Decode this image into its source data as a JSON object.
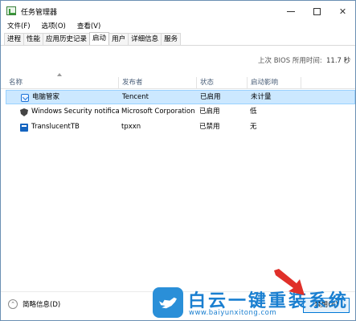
{
  "window": {
    "title": "任务管理器",
    "controls": {
      "minimize": "—",
      "maximize": "",
      "close": "✕"
    }
  },
  "menu": [
    "文件(F)",
    "选项(O)",
    "查看(V)"
  ],
  "tabs": [
    "进程",
    "性能",
    "应用历史记录",
    "启动",
    "用户",
    "详细信息",
    "服务"
  ],
  "active_tab": "启动",
  "bios": {
    "label": "上次 BIOS 所用时间:",
    "value": "11.7 秒"
  },
  "table": {
    "columns": [
      "名称",
      "发布者",
      "状态",
      "启动影响"
    ],
    "rows": [
      {
        "icon": "tencent-pc-manager-icon",
        "name": "电脑管家",
        "publisher": "Tencent",
        "status": "已启用",
        "impact": "未计量",
        "selected": true
      },
      {
        "icon": "shield-icon",
        "name": "Windows Security notifica...",
        "publisher": "Microsoft Corporation",
        "status": "已启用",
        "impact": "低",
        "selected": false
      },
      {
        "icon": "translucenttb-icon",
        "name": "TranslucentTB",
        "publisher": "tpxxn",
        "status": "已禁用",
        "impact": "无",
        "selected": false
      }
    ]
  },
  "footer": {
    "less_info": "简略信息(D)",
    "disable_button": "禁用(A)"
  },
  "watermark": {
    "title": "白云一键重装系统",
    "url": "www.baiyunxitong.com"
  },
  "colors": {
    "selection": "#cce8ff",
    "selection_border": "#99d1ff",
    "button_border": "#0078d7",
    "watermark": "#1a7fd0",
    "arrow": "#e0302a"
  }
}
